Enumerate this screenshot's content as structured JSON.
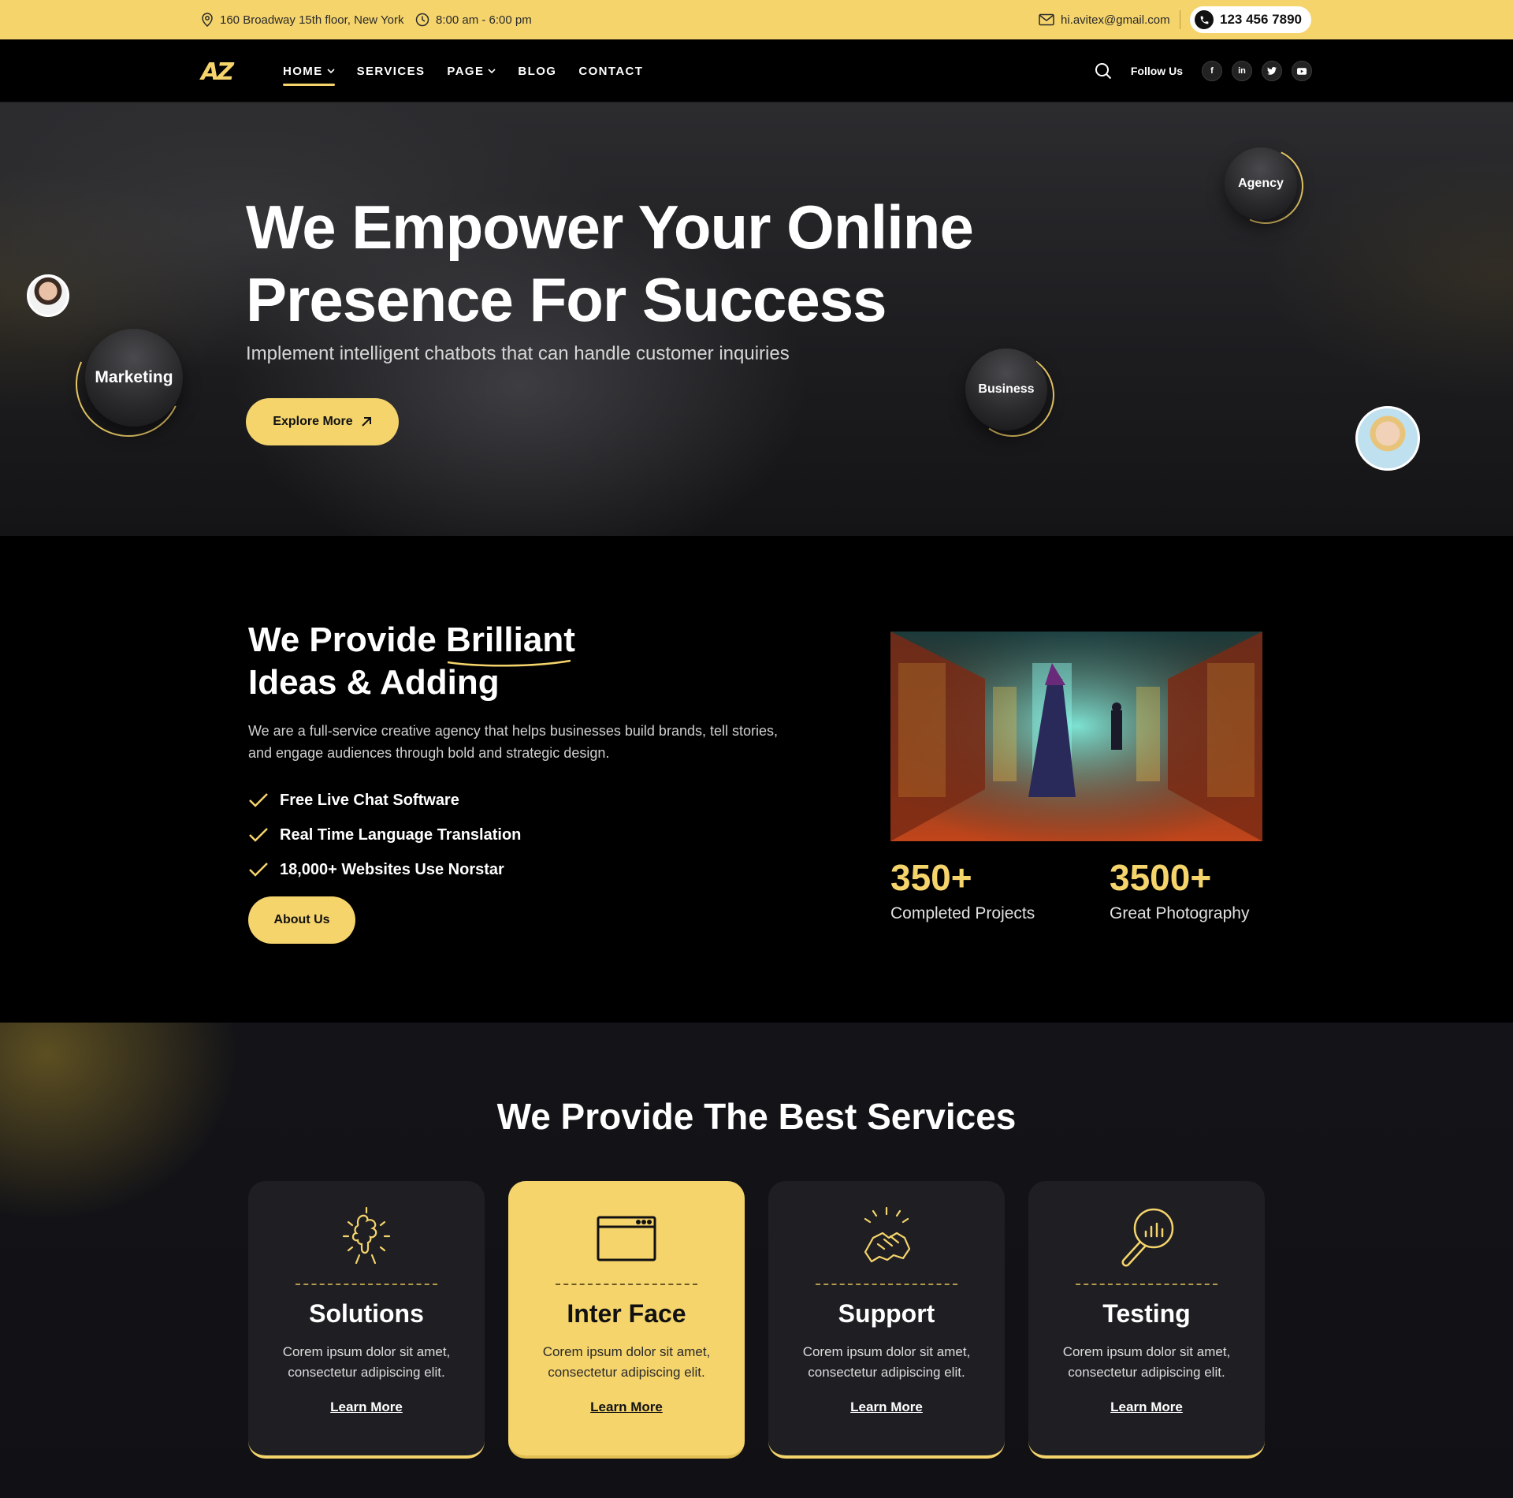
{
  "topbar": {
    "address": "160 Broadway 15th floor, New York",
    "hours": "8:00 am - 6:00 pm",
    "email": "hi.avitex@gmail.com",
    "phone": "123 456 7890"
  },
  "nav": {
    "logo": "AZ",
    "items": [
      {
        "label": "HOME",
        "dropdown": true,
        "active": true
      },
      {
        "label": "SERVICES",
        "dropdown": false
      },
      {
        "label": "PAGE",
        "dropdown": true
      },
      {
        "label": "BLOG",
        "dropdown": false
      },
      {
        "label": "CONTACT",
        "dropdown": false
      }
    ],
    "follow_label": "Follow Us",
    "socials": [
      "facebook-icon",
      "linkedin-icon",
      "twitter-icon",
      "youtube-icon"
    ]
  },
  "hero": {
    "title_line1": "We Empower Your Online",
    "title_line2": "Presence For Success",
    "subtitle": "Implement intelligent chatbots that can handle customer inquiries",
    "button_label": "Explore More",
    "bubbles": {
      "marketing": "Marketing",
      "business": "Business",
      "agency": "Agency"
    }
  },
  "about": {
    "title_part1": "We Provide ",
    "title_highlight": "Brilliant",
    "title_line2": "Ideas & Adding",
    "text": "We are a full-service creative agency that helps businesses build brands, tell stories, and engage audiences through bold and strategic design.",
    "features": [
      "Free Live Chat Software",
      "Real Time Language Translation",
      "18,000+ Websites Use Norstar"
    ],
    "button_label": "About Us",
    "stats": [
      {
        "value": "350+",
        "label": "Completed Projects"
      },
      {
        "value": "3500+",
        "label": "Great Photography"
      }
    ]
  },
  "services": {
    "title": "We Provide The Best Services",
    "cards": [
      {
        "title": "Solutions",
        "desc": "Corem ipsum dolor sit amet, consectetur adipiscing elit.",
        "link": "Learn More",
        "icon": "puzzle-head-icon"
      },
      {
        "title": "Inter Face",
        "desc": "Corem ipsum dolor sit amet, consectetur adipiscing elit.",
        "link": "Learn More",
        "icon": "browser-window-icon"
      },
      {
        "title": "Support",
        "desc": "Corem ipsum dolor sit amet, consectetur adipiscing elit.",
        "link": "Learn More",
        "icon": "handshake-icon"
      },
      {
        "title": "Testing",
        "desc": "Corem ipsum dolor sit amet, consectetur adipiscing elit.",
        "link": "Learn More",
        "icon": "magnifier-chart-icon"
      }
    ]
  },
  "colors": {
    "accent": "#f5d46c",
    "background": "#000000",
    "card": "#1f1f23"
  }
}
